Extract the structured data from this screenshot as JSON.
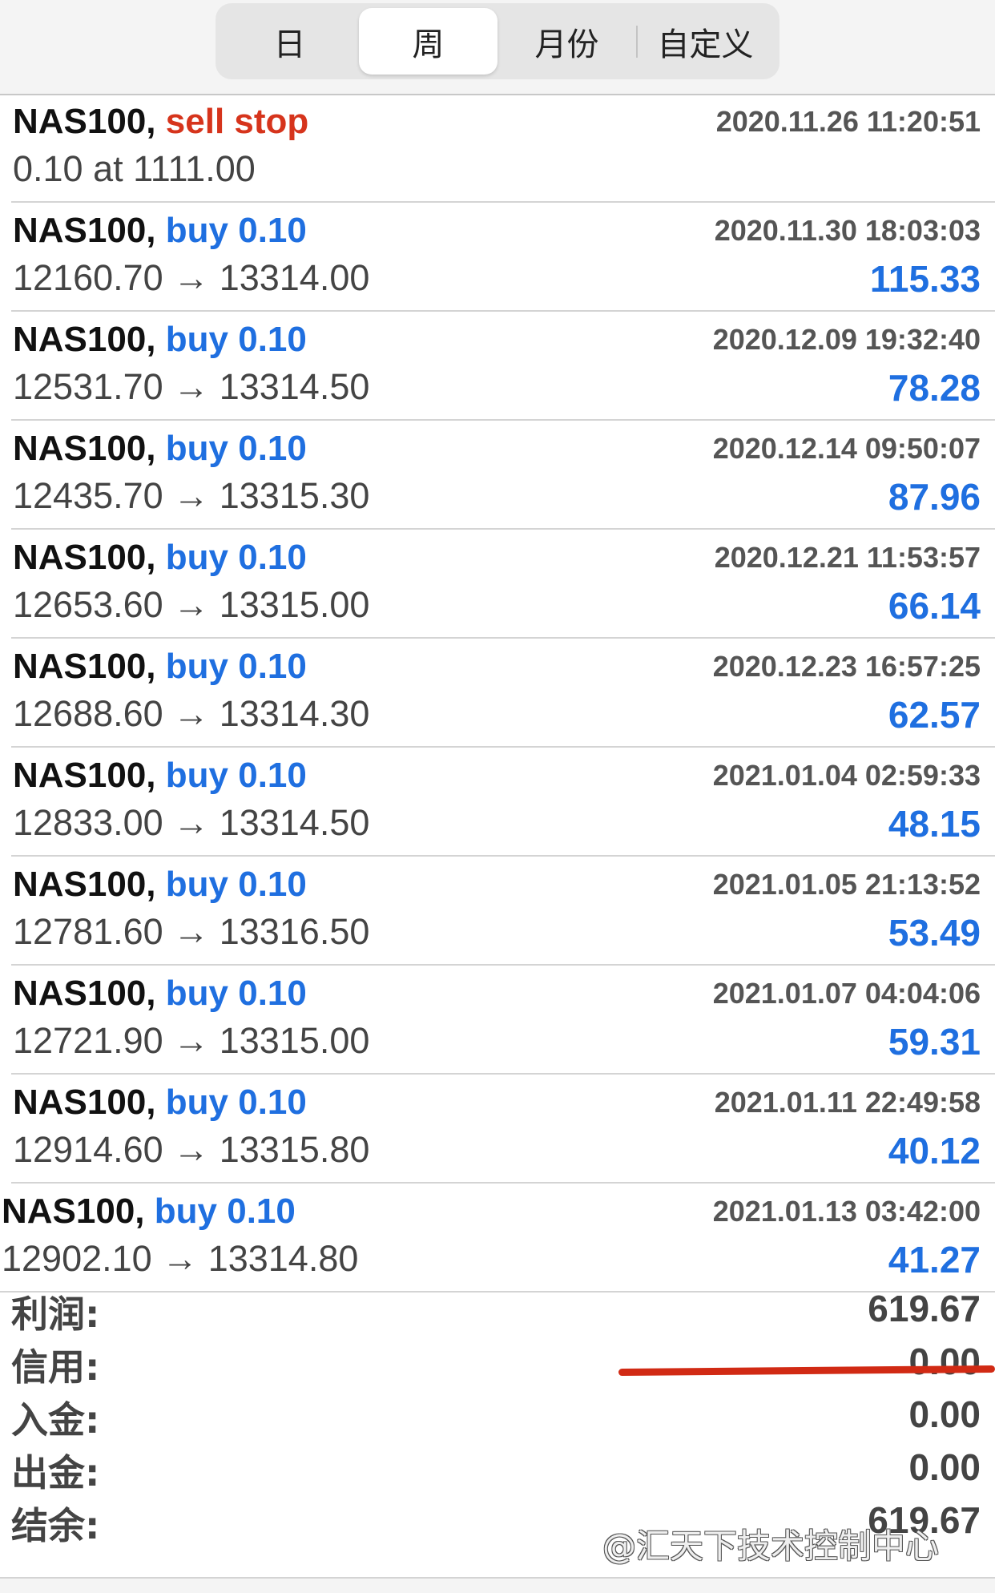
{
  "tabs": [
    {
      "label": "日"
    },
    {
      "label": "周"
    },
    {
      "label": "月份"
    },
    {
      "label": "自定义"
    }
  ],
  "active_tab": "周",
  "orders": [
    {
      "symbol": "NAS100,",
      "action": "sell stop",
      "type": "sell",
      "time": "2020.11.26 11:20:51",
      "detail": "0.10 at 1111.00",
      "profit": ""
    },
    {
      "symbol": "NAS100,",
      "action": "buy 0.10",
      "type": "buy",
      "time": "2020.11.30 18:03:03",
      "detail": "12160.70 → 13314.00",
      "profit": "115.33"
    },
    {
      "symbol": "NAS100,",
      "action": "buy 0.10",
      "type": "buy",
      "time": "2020.12.09 19:32:40",
      "detail": "12531.70 → 13314.50",
      "profit": "78.28"
    },
    {
      "symbol": "NAS100,",
      "action": "buy 0.10",
      "type": "buy",
      "time": "2020.12.14 09:50:07",
      "detail": "12435.70 → 13315.30",
      "profit": "87.96"
    },
    {
      "symbol": "NAS100,",
      "action": "buy 0.10",
      "type": "buy",
      "time": "2020.12.21 11:53:57",
      "detail": "12653.60 → 13315.00",
      "profit": "66.14"
    },
    {
      "symbol": "NAS100,",
      "action": "buy 0.10",
      "type": "buy",
      "time": "2020.12.23 16:57:25",
      "detail": "12688.60 → 13314.30",
      "profit": "62.57"
    },
    {
      "symbol": "NAS100,",
      "action": "buy 0.10",
      "type": "buy",
      "time": "2021.01.04 02:59:33",
      "detail": "12833.00 → 13314.50",
      "profit": "48.15"
    },
    {
      "symbol": "NAS100,",
      "action": "buy 0.10",
      "type": "buy",
      "time": "2021.01.05 21:13:52",
      "detail": "12781.60 → 13316.50",
      "profit": "53.49"
    },
    {
      "symbol": "NAS100,",
      "action": "buy 0.10",
      "type": "buy",
      "time": "2021.01.07 04:04:06",
      "detail": "12721.90 → 13315.00",
      "profit": "59.31"
    },
    {
      "symbol": "NAS100,",
      "action": "buy 0.10",
      "type": "buy",
      "time": "2021.01.11 22:49:58",
      "detail": "12914.60 → 13315.80",
      "profit": "40.12"
    },
    {
      "symbol": "NAS100,",
      "action": "buy 0.10",
      "type": "buy",
      "time": "2021.01.13 03:42:00",
      "detail": "12902.10 → 13314.80",
      "profit": "41.27"
    }
  ],
  "summary": [
    {
      "label": "利润:",
      "value": "619.67"
    },
    {
      "label": "信用:",
      "value": "0.00"
    },
    {
      "label": "入金:",
      "value": "0.00"
    },
    {
      "label": "出金:",
      "value": "0.00"
    },
    {
      "label": "结余:",
      "value": "619.67"
    }
  ],
  "watermark": "@汇天下技术控制中心",
  "colors": {
    "buy": "#1f6fe0",
    "sell": "#d6341c",
    "annotation_line": "#d12a14"
  }
}
